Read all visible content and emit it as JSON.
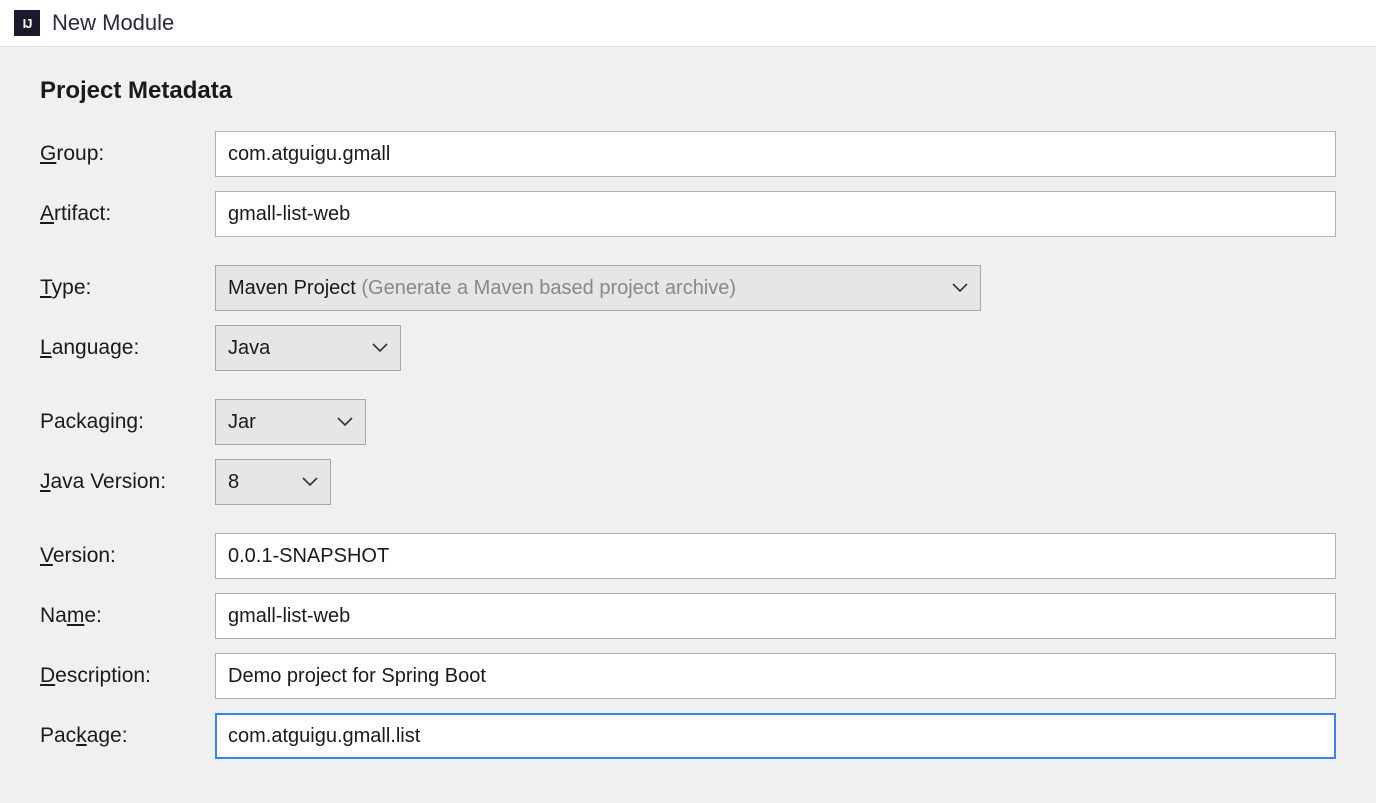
{
  "header": {
    "app_icon_label": "IJ",
    "title": "New Module"
  },
  "section": {
    "title": "Project Metadata"
  },
  "labels": {
    "group_pre": "",
    "group_m": "G",
    "group_post": "roup:",
    "artifact_pre": "",
    "artifact_m": "A",
    "artifact_post": "rtifact:",
    "type_pre": "",
    "type_m": "T",
    "type_post": "ype:",
    "language_pre": "",
    "language_m": "L",
    "language_post": "anguage:",
    "packaging_pre": "Packa",
    "packaging_m": "g",
    "packaging_post": "ing:",
    "javaversion_pre": "",
    "javaversion_m": "J",
    "javaversion_post": "ava Version:",
    "version_pre": "",
    "version_m": "V",
    "version_post": "ersion:",
    "name_pre": "Na",
    "name_m": "m",
    "name_post": "e:",
    "description_pre": "",
    "description_m": "D",
    "description_post": "escription:",
    "package_pre": "Pac",
    "package_m": "k",
    "package_post": "age:"
  },
  "fields": {
    "group": "com.atguigu.gmall",
    "artifact": "gmall-list-web",
    "type_main": "Maven Project",
    "type_hint": " (Generate a Maven based project archive)",
    "language": "Java",
    "packaging": "Jar",
    "java_version": "8",
    "version": "0.0.1-SNAPSHOT",
    "name": "gmall-list-web",
    "description": "Demo project for Spring Boot",
    "package": "com.atguigu.gmall.list"
  }
}
